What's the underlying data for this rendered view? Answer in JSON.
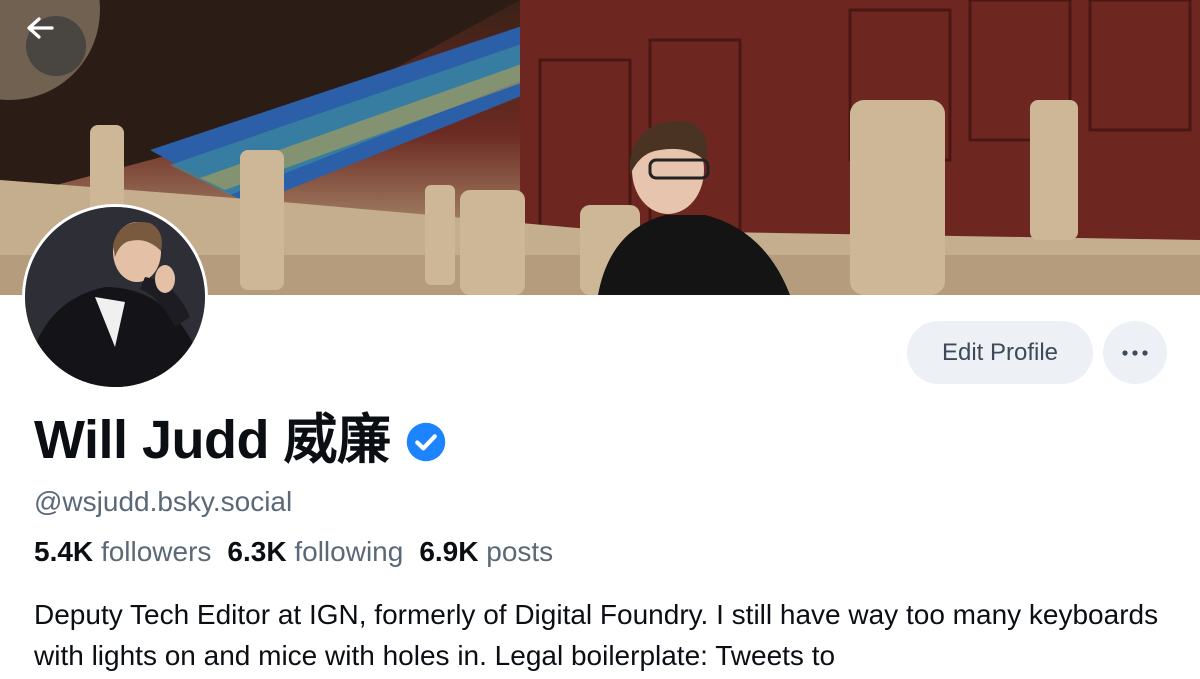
{
  "profile": {
    "display_name": "Will Judd 威廉",
    "handle": "@wsjudd.bsky.social",
    "bio": "Deputy Tech Editor at IGN, formerly of Digital Foundry. I still have way too many keyboards with lights on and mice with holes in. Legal boilerplate: Tweets to",
    "verified": true
  },
  "stats": {
    "followers_count": "5.4K",
    "followers_label": "followers",
    "following_count": "6.3K",
    "following_label": "following",
    "posts_count": "6.9K",
    "posts_label": "posts"
  },
  "actions": {
    "edit_label": "Edit Profile",
    "more_icon": "more-horizontal-icon"
  },
  "navigation": {
    "back_icon": "arrow-left-icon"
  },
  "colors": {
    "verified_badge": "#1d84ff",
    "button_bg": "#edf0f4",
    "secondary_text": "#5b6877"
  }
}
